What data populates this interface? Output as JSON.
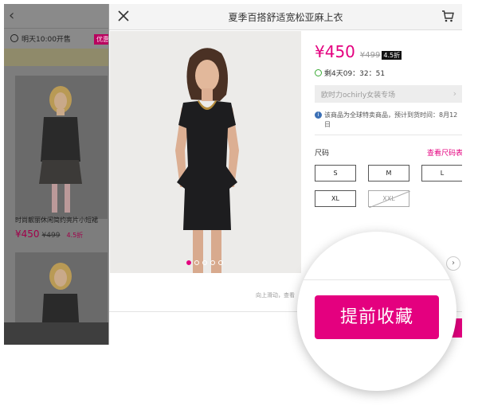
{
  "background_page": {
    "back_icon": "chevron-left-icon",
    "sale_time": "明天10:00开售",
    "badge": "优惠",
    "product_caption": "时尚靓丽休闲简约亮片小短裙",
    "price": "¥450",
    "old_price": "¥499",
    "discount": "4.5折"
  },
  "modal": {
    "close_icon": "close-icon",
    "title": "夏季百搭舒适宽松亚麻上衣",
    "cart_icon": "cart-icon",
    "price": "¥450",
    "old_price": "¥499",
    "discount": "4.5折",
    "countdown": "剩4天09：32：51",
    "brand_store": "欧时力ochirly女装专场",
    "notice": "该商品为全球特卖商品，预计到货时间：8月12日",
    "size_label": "尺码",
    "size_chart": "查看尺码表",
    "sizes": [
      {
        "label": "S",
        "available": true
      },
      {
        "label": "M",
        "available": true
      },
      {
        "label": "L",
        "available": true
      },
      {
        "label": "XL",
        "available": true
      },
      {
        "label": "XXL",
        "available": false
      }
    ],
    "scroll_hint": "向上滑动，查看",
    "image_pager": {
      "total": 5,
      "current": 1
    },
    "colors": {
      "accent": "#e4007f",
      "countdown": "#3aaa35"
    }
  },
  "cta": {
    "label": "提前收藏"
  }
}
